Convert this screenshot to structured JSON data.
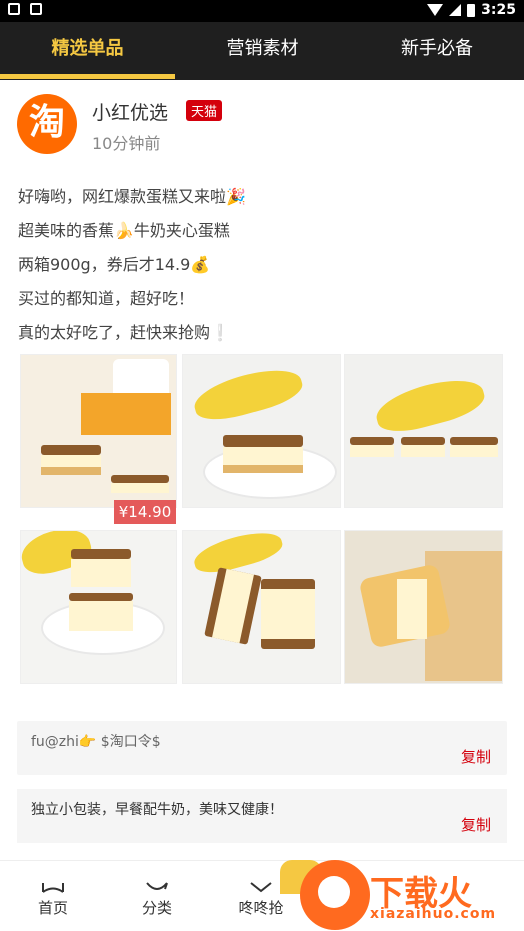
{
  "status": {
    "time": "3:25"
  },
  "nav": {
    "tabs": [
      "精选单品",
      "营销素材",
      "新手必备"
    ],
    "active": 0
  },
  "post": {
    "avatar_char": "淘",
    "username": "小红优选",
    "badge": "天猫",
    "timestamp": "10分钟前",
    "lines": [
      "好嗨哟，网红爆款蛋糕又来啦🎉",
      "超美味的香蕉🍌牛奶夹心蛋糕",
      "两箱900g，券后才14.9💰",
      "买过的都知道，超好吃！",
      "真的太好吃了，赶快来抢购❕"
    ],
    "price_tag": "¥14.90",
    "photo_count": 6
  },
  "command_box": {
    "text": "fu@zhi👉 $淘口令$",
    "copy_label": "复制"
  },
  "tip_box": {
    "text": "独立小包装，早餐配牛奶，美味又健康！",
    "copy_label": "复制"
  },
  "bottom_nav": {
    "items": [
      {
        "label": "首页",
        "icon": "home-icon"
      },
      {
        "label": "分类",
        "icon": "category-icon"
      },
      {
        "label": "咚咚抢",
        "icon": "flash-icon"
      }
    ]
  },
  "watermark": {
    "title": "下载火",
    "sub": "xiazaihuo.com"
  },
  "colors": {
    "accent": "#f5c842",
    "nav_bg": "#1f1f1f",
    "copy": "#d4000c",
    "tmall": "#d4000c",
    "price": "#e45a5a",
    "avatar": "#ff6a00"
  }
}
